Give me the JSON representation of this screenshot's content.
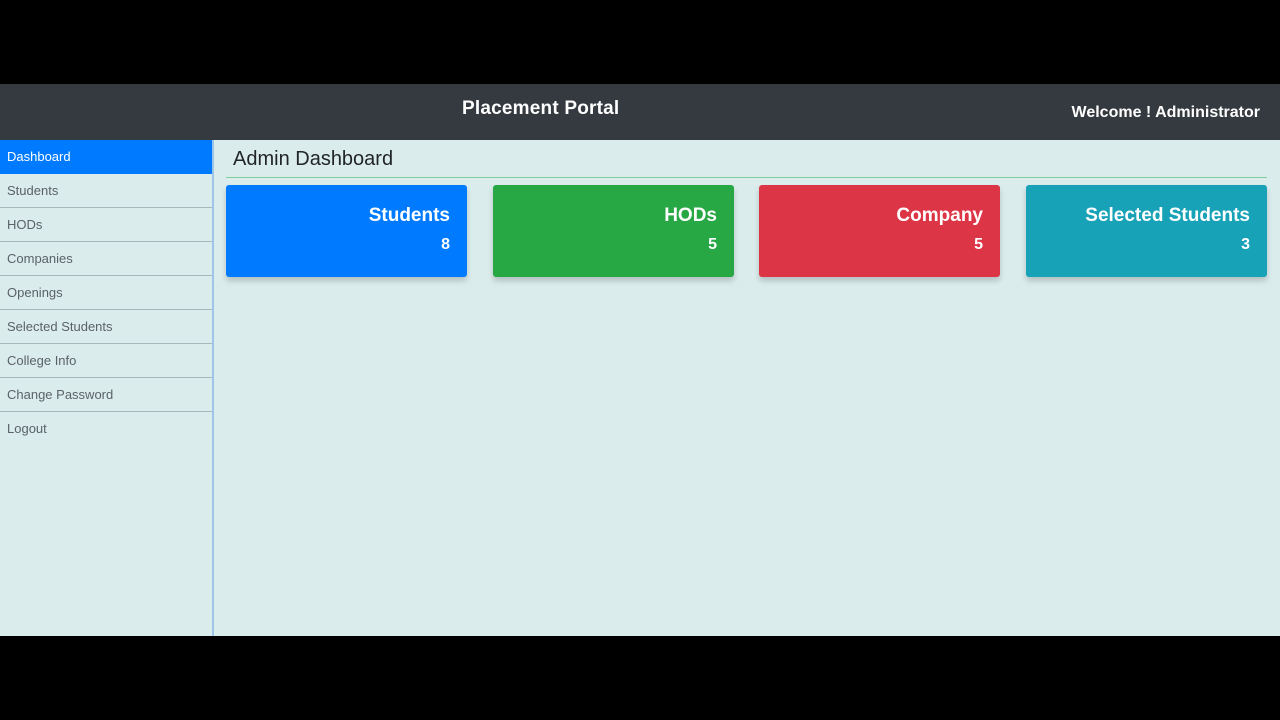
{
  "header": {
    "title": "Placement Portal",
    "welcome": "Welcome ! Administrator"
  },
  "sidebar": {
    "items": [
      {
        "label": "Dashboard",
        "active": true
      },
      {
        "label": "Students",
        "active": false
      },
      {
        "label": "HODs",
        "active": false
      },
      {
        "label": "Companies",
        "active": false
      },
      {
        "label": "Openings",
        "active": false
      },
      {
        "label": "Selected Students",
        "active": false
      },
      {
        "label": "College Info",
        "active": false
      },
      {
        "label": "Change Password",
        "active": false
      },
      {
        "label": "Logout",
        "active": false
      }
    ]
  },
  "main": {
    "title": "Admin Dashboard",
    "cards": [
      {
        "label": "Students",
        "value": "8",
        "color": "#007bff"
      },
      {
        "label": "HODs",
        "value": "5",
        "color": "#28a745"
      },
      {
        "label": "Company",
        "value": "5",
        "color": "#dc3545"
      },
      {
        "label": "Selected Students",
        "value": "3",
        "color": "#17a2b8"
      }
    ]
  },
  "colors": {
    "topbar": "#343a40",
    "background": "#dbecec",
    "active": "#007bff"
  }
}
